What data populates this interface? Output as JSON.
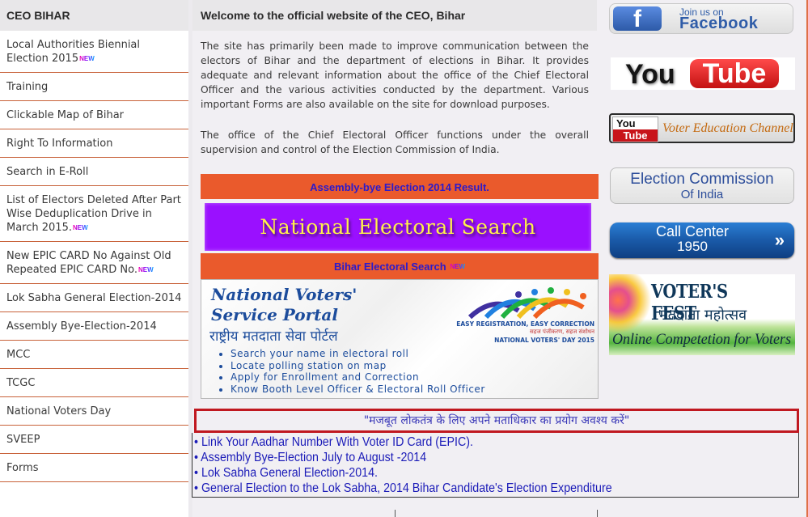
{
  "sidebar": {
    "title": "CEO BIHAR",
    "new_badge": "NEW",
    "items": [
      {
        "label": "Local Authorities Biennial Election 2015",
        "new": true
      },
      {
        "label": "Training",
        "new": false
      },
      {
        "label": "Clickable Map of Bihar",
        "new": false
      },
      {
        "label": "Right To Information",
        "new": false
      },
      {
        "label": "Search in E-Roll",
        "new": false
      },
      {
        "label": "List of Electors Deleted After Part Wise Deduplication Drive in March 2015.",
        "new": true
      },
      {
        "label": "New EPIC CARD No Against Old Repeated EPIC CARD No.",
        "new": true
      },
      {
        "label": "Lok Sabha General Election-2014",
        "new": false
      },
      {
        "label": "Assembly Bye-Election-2014",
        "new": false
      },
      {
        "label": "MCC",
        "new": false
      },
      {
        "label": "TCGC",
        "new": false
      },
      {
        "label": "National Voters Day",
        "new": false
      },
      {
        "label": "SVEEP",
        "new": false
      },
      {
        "label": "Forms",
        "new": false
      }
    ]
  },
  "main": {
    "title": "Welcome to the official website of the CEO, Bihar",
    "intro_1": "The site has primarily been made to improve communication between the electors of Bihar and the department of elections in Bihar. It provides adequate and relevant information about the office of the Chief Electoral Officer and the various activities conducted by the department. Various important Forms are also available on the site for download purposes.",
    "intro_2": "The office of the Chief Electoral Officer functions under the overall supervision and control of the Election Commission of India.",
    "bye_result_link": "Assembly-bye Election 2014 Result.",
    "nes_banner": "National Electoral Search",
    "bihar_search_link": "Bihar Electoral Search",
    "nvsp": {
      "title_1": "National Voters'",
      "title_2": "Service Portal",
      "hindi": "राष्ट्रीय मतदाता सेवा पोर्टल",
      "tag_1": "EASY REGISTRATION, EASY CORRECTION",
      "tag_2": "सहज पंजीकरण, सहज संशोधन",
      "tag_3": "NATIONAL VOTERS' DAY 2015",
      "bullets": [
        "Search your name in electoral roll",
        "Locate polling station on map",
        "Apply for Enrollment and Correction",
        "Know Booth Level Officer & Electoral Roll Officer"
      ]
    },
    "quote": "\"मजबूत लोकतंत्र के लिए अपने मताधिकार का प्रयोग अवश्य करें\"",
    "links": [
      "• Link Your Aadhar Number With Voter ID Card (EPIC).",
      "• Assembly Bye-Election July to August -2014",
      "• Lok Sabha General Election-2014.",
      "• General Election to the Lok Sabha, 2014 Bihar Candidate's Election Expenditure"
    ]
  },
  "right": {
    "facebook": {
      "line1": "Join us on",
      "line2": "Facebook",
      "icon": "f"
    },
    "youtube": {
      "you": "You",
      "tube": "Tube"
    },
    "youtube_channel": {
      "you": "You",
      "tube": "Tube",
      "label": "Voter Education Channel"
    },
    "eci": {
      "line1": "Election Commission",
      "line2": "Of India"
    },
    "call_center": {
      "line1": "Call Center",
      "line2": "1950",
      "arrow": "»"
    },
    "voters_fest": {
      "title": "VOTER'S FEST",
      "hindi": "मतदाता महोत्सव",
      "subtitle": "Online Competetion for Voters"
    }
  },
  "colors": {
    "accent_orange": "#ea5a2c",
    "link_blue": "#1b1bb8",
    "banner_purple": "#9a10ff",
    "quote_border": "#c01820"
  }
}
